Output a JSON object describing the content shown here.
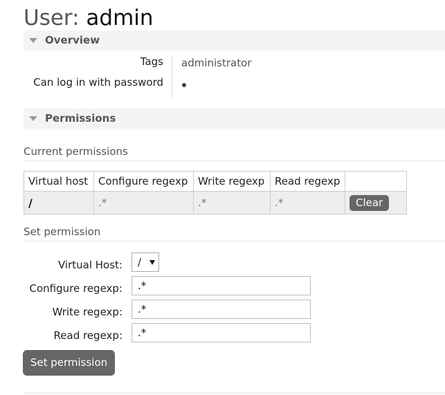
{
  "page": {
    "title_prefix": "User:",
    "title_user": "admin"
  },
  "overview": {
    "title": "Overview",
    "tags_label": "Tags",
    "tags_value": "administrator",
    "can_login_label": "Can log in with password",
    "can_login_icon": "bullet-dot-icon"
  },
  "permissions": {
    "title": "Permissions",
    "current_heading": "Current permissions",
    "columns": [
      "Virtual host",
      "Configure regexp",
      "Write regexp",
      "Read regexp",
      ""
    ],
    "rows": [
      {
        "vhost": "/",
        "configure": ".*",
        "write": ".*",
        "read": ".*",
        "action": "Clear"
      }
    ]
  },
  "set_permission": {
    "heading": "Set permission",
    "virtual_host_label": "Virtual Host:",
    "virtual_host_value": "/",
    "configure_label": "Configure regexp:",
    "configure_value": ".*",
    "write_label": "Write regexp:",
    "write_value": ".*",
    "read_label": "Read regexp:",
    "read_value": ".*",
    "submit_label": "Set permission"
  },
  "colors": {
    "button_bg": "#666666",
    "section_bg": "#f4f4f4",
    "table_row_bg": "#eeeeee"
  }
}
